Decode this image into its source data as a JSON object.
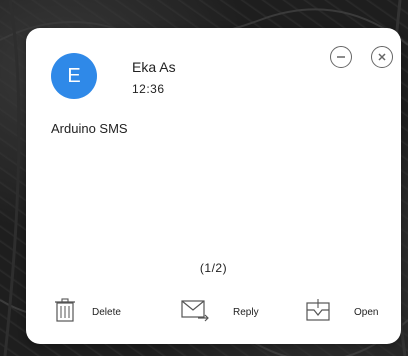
{
  "notification": {
    "avatar_letter": "E",
    "sender": "Eka As",
    "time": "12:36",
    "message": "Arduino SMS",
    "page_indicator": "(1/2)"
  },
  "actions": {
    "delete_label": "Delete",
    "reply_label": "Reply",
    "open_label": "Open"
  },
  "icons": {
    "minimize": "minimize-icon",
    "close": "close-icon",
    "delete": "trash-icon",
    "reply": "reply-envelope-icon",
    "open": "open-inbox-icon"
  },
  "colors": {
    "avatar": "#2f89e8",
    "card": "#ffffff"
  }
}
